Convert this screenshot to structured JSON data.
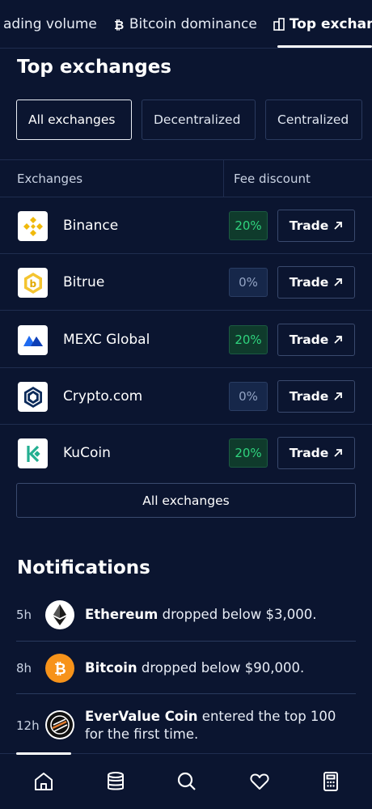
{
  "tabs": [
    {
      "label": "ading volume",
      "icon": "chart-icon",
      "active": false
    },
    {
      "label": "Bitcoin dominance",
      "icon": "bitcoin-icon",
      "active": false
    },
    {
      "label": "Top exchan",
      "icon": "building-icon",
      "active": true
    }
  ],
  "exchanges_section": {
    "title": "Top exchanges",
    "filters": [
      {
        "label": "All exchanges",
        "active": true
      },
      {
        "label": "Decentralized",
        "active": false
      },
      {
        "label": "Centralized",
        "active": false
      }
    ],
    "columns": {
      "exchange": "Exchanges",
      "fee": "Fee discount"
    },
    "rows": [
      {
        "name": "Binance",
        "fee": "20%",
        "fee_status": "positive",
        "trade_label": "Trade",
        "icon": "binance-logo-icon"
      },
      {
        "name": "Bitrue",
        "fee": "0%",
        "fee_status": "neutral",
        "trade_label": "Trade",
        "icon": "bitrue-logo-icon"
      },
      {
        "name": "MEXC Global",
        "fee": "20%",
        "fee_status": "positive",
        "trade_label": "Trade",
        "icon": "mexc-logo-icon"
      },
      {
        "name": "Crypto.com",
        "fee": "0%",
        "fee_status": "neutral",
        "trade_label": "Trade",
        "icon": "cryptocom-logo-icon"
      },
      {
        "name": "KuCoin",
        "fee": "20%",
        "fee_status": "positive",
        "trade_label": "Trade",
        "icon": "kucoin-logo-icon"
      }
    ],
    "all_button_label": "All exchanges"
  },
  "notifications_section": {
    "title": "Notifications",
    "items": [
      {
        "time": "5h",
        "coin": "Ethereum",
        "message": " dropped below $3,000.",
        "icon": "ethereum-icon"
      },
      {
        "time": "8h",
        "coin": "Bitcoin",
        "message": " dropped below $90,000.",
        "icon": "bitcoin-coin-icon"
      },
      {
        "time": "12h",
        "coin": "EverValue Coin",
        "message": " entered the top 100 for the first time.",
        "icon": "evervalue-coin-icon"
      }
    ]
  },
  "bottom_nav": [
    {
      "icon": "home-icon",
      "active": true
    },
    {
      "icon": "database-icon",
      "active": false
    },
    {
      "icon": "search-icon",
      "active": false
    },
    {
      "icon": "heart-icon",
      "active": false
    },
    {
      "icon": "calculator-icon",
      "active": false
    }
  ],
  "colors": {
    "background": "#0b1530",
    "positive": "#2fd47e",
    "neutral": "#93a4c4",
    "binance": "#f0b90b",
    "bitcoin": "#f7931a"
  }
}
